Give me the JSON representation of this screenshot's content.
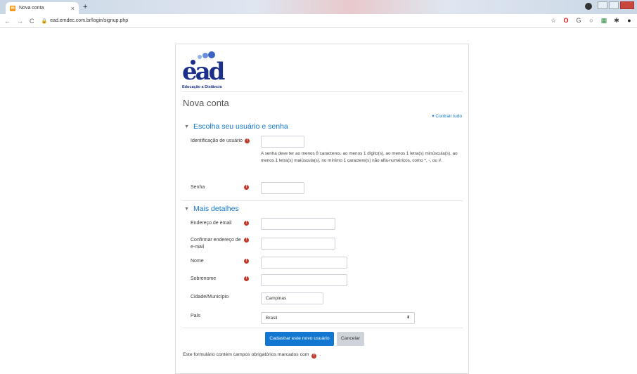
{
  "browser": {
    "tab_title": "Nova conta",
    "url": "ead.emdec.com.br/login/signup.php"
  },
  "logo": {
    "word": "ead",
    "tagline": "Educação a Distância"
  },
  "page": {
    "title": "Nova conta",
    "collapse_all": "Contrair tudo"
  },
  "section1": {
    "title": "Escolha seu usuário e senha",
    "username_label": "Identificação de usuário",
    "password_help": "A senha deve ter ao menos 8 caracteres, ao menos 1 dígito(s), ao menos 1 letra(s) minúscula(s), ao menos 1 letra(s) maiúscula(s), no mínimo 1 caractere(s) não alfa-numéricos, como *, -, ou #.",
    "password_label": "Senha"
  },
  "section2": {
    "title": "Mais detalhes",
    "email_label": "Endereço de email",
    "email_confirm_label": "Confirmar endereço de e-mail",
    "firstname_label": "Nome",
    "lastname_label": "Sobrenome",
    "city_label": "Cidade/Município",
    "city_value": "Campinas",
    "country_label": "País",
    "country_value": "Brasil"
  },
  "actions": {
    "submit": "Cadastrar este novo usuário",
    "cancel": "Cancelar"
  },
  "footnote": {
    "text": "Este formulário contém campos obrigatórios marcados com",
    "suffix": "."
  },
  "colors": {
    "link": "#1177d1",
    "required": "#c0392b",
    "logo": "#1c2f8c"
  }
}
